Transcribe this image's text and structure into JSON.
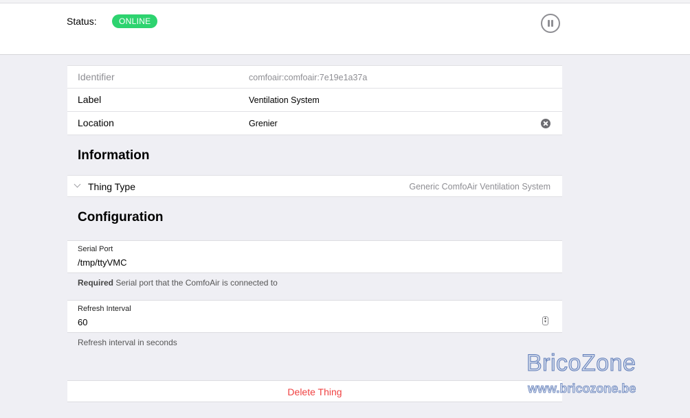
{
  "header": {
    "status_label": "Status:",
    "status_badge": "ONLINE",
    "status_color": "#2dd36f"
  },
  "properties": [
    {
      "label": "Identifier",
      "value": "comfoair:comfoair:7e19e1a37a"
    },
    {
      "label": "Label",
      "value": "Ventilation System"
    },
    {
      "label": "Location",
      "value": "Grenier"
    }
  ],
  "information": {
    "title": "Information",
    "thing_type_label": "Thing Type",
    "thing_type_value": "Generic ComfoAir Ventilation System"
  },
  "configuration": {
    "title": "Configuration",
    "serial_port": {
      "label": "Serial Port",
      "value": "/tmp/ttyVMC",
      "required": "Required",
      "help": "Serial port that the ComfoAir is connected to"
    },
    "refresh_interval": {
      "label": "Refresh Interval",
      "value": "60",
      "help": "Refresh interval in seconds"
    }
  },
  "delete_label": "Delete Thing",
  "delete_color": "#f04141",
  "watermark": {
    "line1": "BricoZone",
    "line2": "www.bricozone.be"
  },
  "icons": {
    "pause": "pause-circle-icon",
    "clear": "clear-circle-icon",
    "chevron": "chevron-down-icon",
    "stepper": "stepper-arrows-icon"
  }
}
